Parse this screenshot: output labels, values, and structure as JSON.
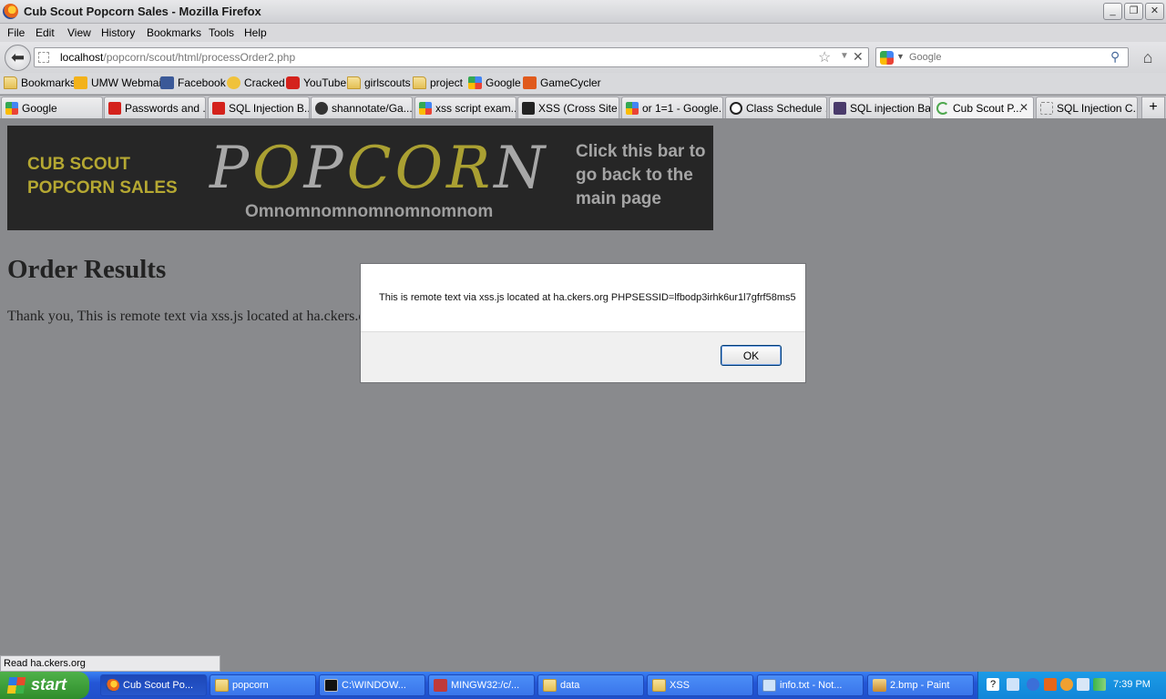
{
  "window": {
    "title": "Cub Scout Popcorn Sales - Mozilla Firefox"
  },
  "menu": [
    "File",
    "Edit",
    "View",
    "History",
    "Bookmarks",
    "Tools",
    "Help"
  ],
  "nav": {
    "url_host": "localhost",
    "url_path": "/popcorn/scout/html/processOrder2.php",
    "search_placeholder": "Google"
  },
  "bookmarks": [
    "Bookmarks",
    "UMW Webmail",
    "Facebook",
    "Cracked",
    "YouTube",
    "girlscouts",
    "project",
    "Google",
    "GameCycler"
  ],
  "tabs": [
    "Google",
    "Passwords and ...",
    "SQL Injection B...",
    "shannotate/Ga...",
    "xss script exam...",
    "XSS (Cross Site ...",
    "or 1=1 - Google...",
    "Class Schedule ...",
    "SQL injection Ba...",
    "Cub Scout P...",
    "SQL Injection C..."
  ],
  "banner": {
    "line1": "CUB SCOUT",
    "line2": "POPCORN SALES",
    "word_p": "P",
    "word_o1": "O",
    "word_p2": "P",
    "word_c": "C",
    "word_o2": "O",
    "word_r": "R",
    "word_n": "N",
    "om": "Omnomnomnomnomnomnom",
    "back": "Click this bar to go back to the main page"
  },
  "page": {
    "title": "Order Results",
    "text": "Thank you, This is remote text via xss.js located at ha.ckers.org P"
  },
  "alert": {
    "message": "This is remote text via xss.js located at ha.ckers.org PHPSESSID=lfbodp3irhk6ur1l7gfrf58ms5",
    "ok": "OK"
  },
  "status": "Read ha.ckers.org",
  "taskbar": {
    "start": "start",
    "items": [
      "Cub Scout Po...",
      "popcorn",
      "C:\\WINDOW...",
      "MINGW32:/c/...",
      "data",
      "XSS",
      "info.txt - Not...",
      "2.bmp - Paint"
    ],
    "clock": "7:39 PM"
  }
}
